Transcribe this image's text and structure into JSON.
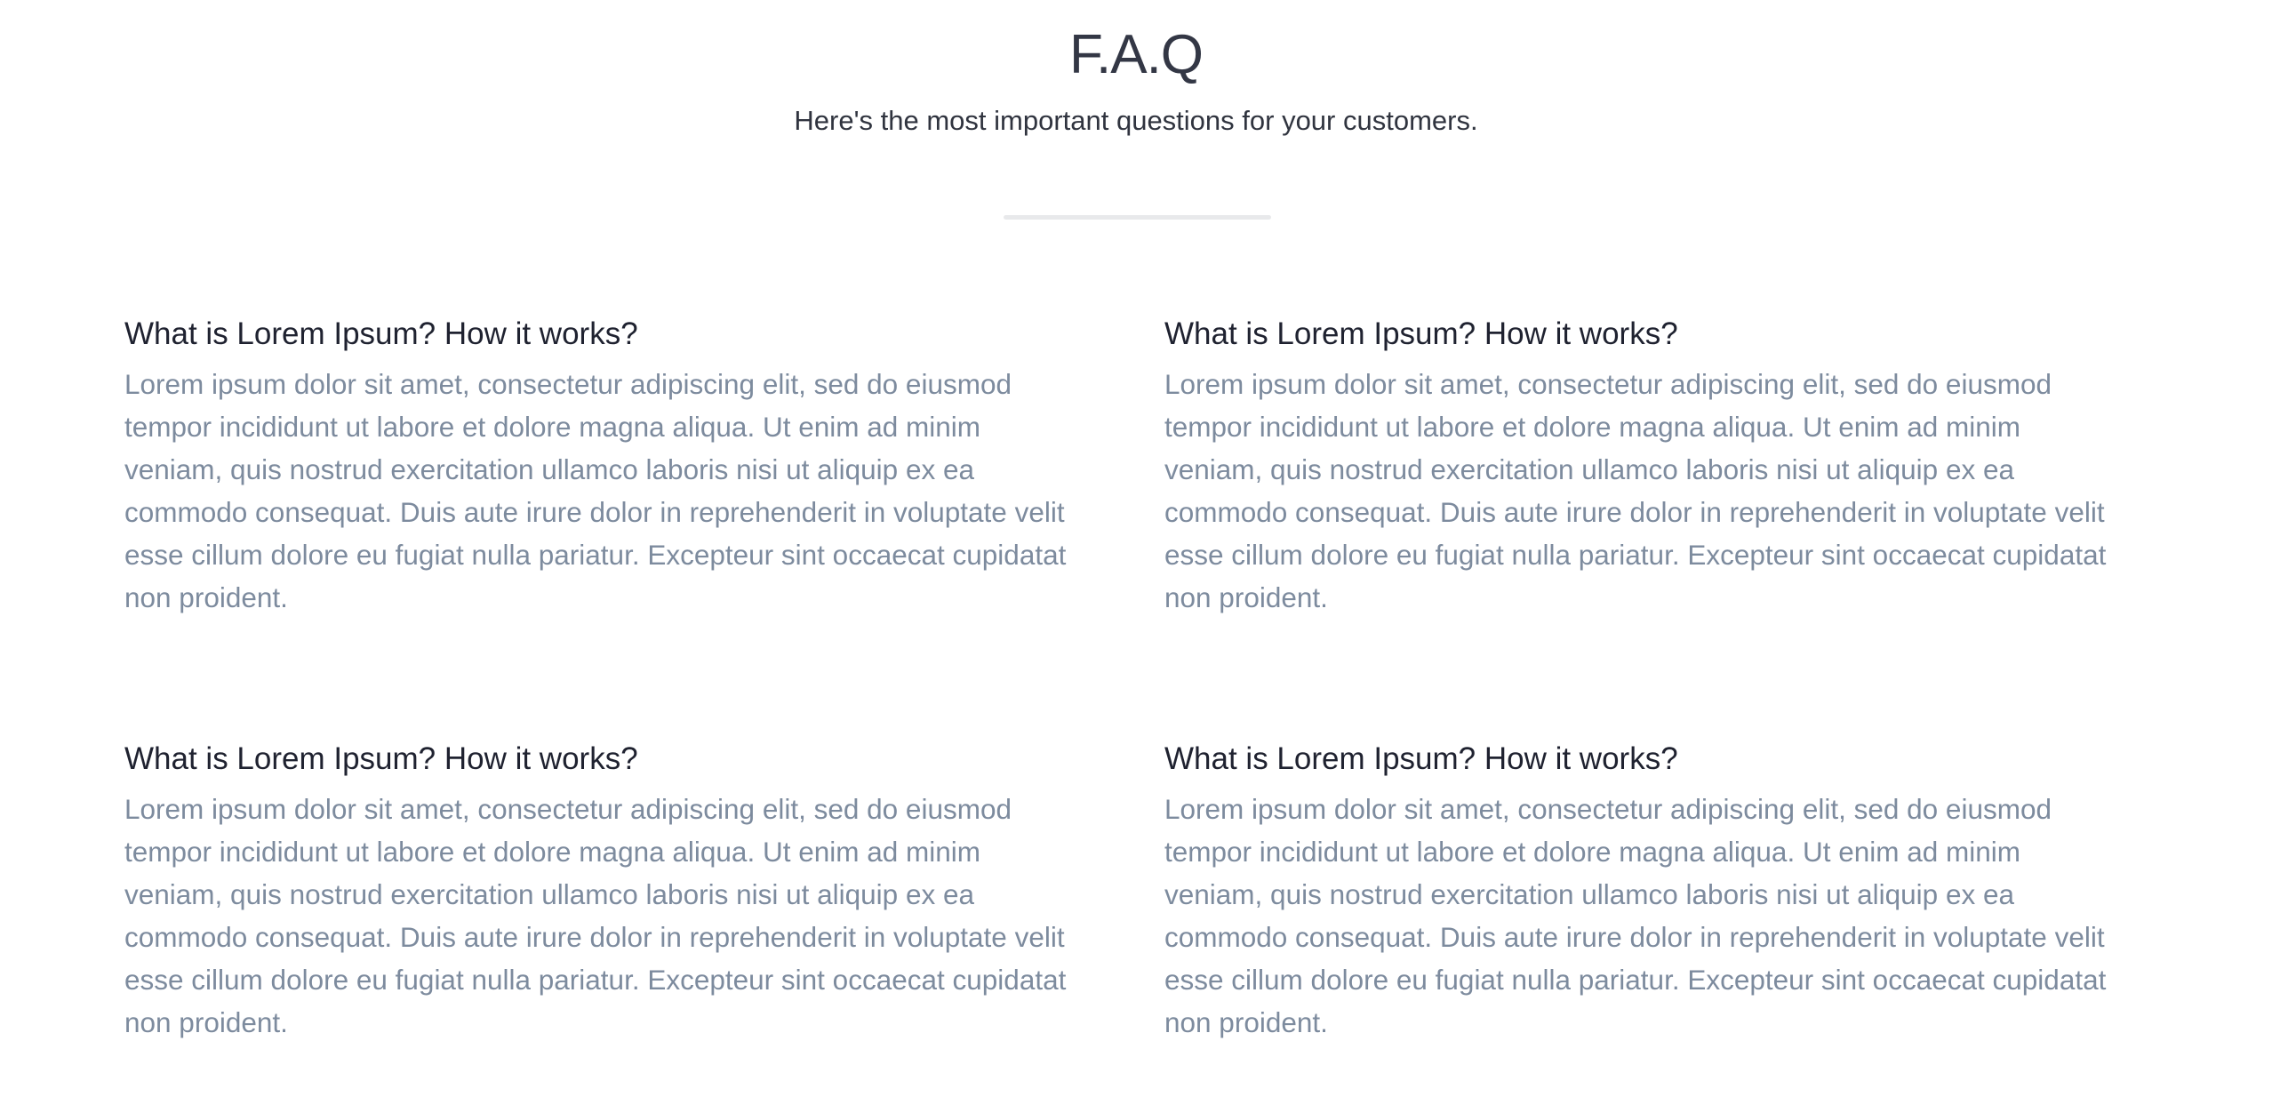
{
  "header": {
    "title": "F.A.Q",
    "subtitle": "Here's the most important questions for your customers."
  },
  "faq": {
    "items": [
      {
        "question": "What is Lorem Ipsum? How it works?",
        "answer": "Lorem ipsum dolor sit amet, consectetur adipiscing elit, sed do eiusmod tempor incididunt ut labore et dolore magna aliqua. Ut enim ad minim veniam, quis nostrud exercitation ullamco laboris nisi ut aliquip ex ea commodo consequat. Duis aute irure dolor in reprehenderit in voluptate velit esse cillum dolore eu fugiat nulla pariatur. Excepteur sint occaecat cupidatat non proident."
      },
      {
        "question": "What is Lorem Ipsum? How it works?",
        "answer": "Lorem ipsum dolor sit amet, consectetur adipiscing elit, sed do eiusmod tempor incididunt ut labore et dolore magna aliqua. Ut enim ad minim veniam, quis nostrud exercitation ullamco laboris nisi ut aliquip ex ea commodo consequat. Duis aute irure dolor in reprehenderit in voluptate velit esse cillum dolore eu fugiat nulla pariatur. Excepteur sint occaecat cupidatat non proident."
      },
      {
        "question": "What is Lorem Ipsum? How it works?",
        "answer": "Lorem ipsum dolor sit amet, consectetur adipiscing elit, sed do eiusmod tempor incididunt ut labore et dolore magna aliqua. Ut enim ad minim veniam, quis nostrud exercitation ullamco laboris nisi ut aliquip ex ea commodo consequat. Duis aute irure dolor in reprehenderit in voluptate velit esse cillum dolore eu fugiat nulla pariatur. Excepteur sint occaecat cupidatat non proident."
      },
      {
        "question": "What is Lorem Ipsum? How it works?",
        "answer": "Lorem ipsum dolor sit amet, consectetur adipiscing elit, sed do eiusmod tempor incididunt ut labore et dolore magna aliqua. Ut enim ad minim veniam, quis nostrud exercitation ullamco laboris nisi ut aliquip ex ea commodo consequat. Duis aute irure dolor in reprehenderit in voluptate velit esse cillum dolore eu fugiat nulla pariatur. Excepteur sint occaecat cupidatat non proident."
      }
    ]
  },
  "colors": {
    "title": "#333745",
    "question": "#1f2230",
    "answer": "#7d8b9e",
    "divider": "#e8e9eb",
    "background": "#ffffff"
  }
}
